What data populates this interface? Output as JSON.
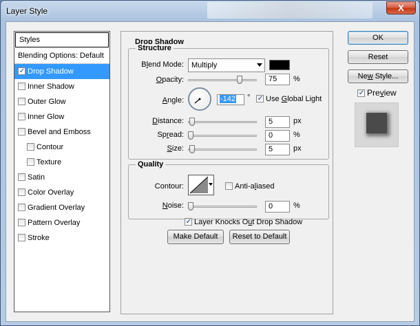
{
  "window": {
    "title": "Layer Style",
    "close_label": "X"
  },
  "styles_list": {
    "header": "Styles",
    "blending_options": "Blending Options: Default",
    "items": [
      {
        "label": "Drop Shadow",
        "checked": true,
        "selected": true,
        "sub": false
      },
      {
        "label": "Inner Shadow",
        "checked": false,
        "selected": false,
        "sub": false
      },
      {
        "label": "Outer Glow",
        "checked": false,
        "selected": false,
        "sub": false
      },
      {
        "label": "Inner Glow",
        "checked": false,
        "selected": false,
        "sub": false
      },
      {
        "label": "Bevel and Emboss",
        "checked": false,
        "selected": false,
        "sub": false
      },
      {
        "label": "Contour",
        "checked": false,
        "selected": false,
        "sub": true
      },
      {
        "label": "Texture",
        "checked": false,
        "selected": false,
        "sub": true
      },
      {
        "label": "Satin",
        "checked": false,
        "selected": false,
        "sub": false
      },
      {
        "label": "Color Overlay",
        "checked": false,
        "selected": false,
        "sub": false
      },
      {
        "label": "Gradient Overlay",
        "checked": false,
        "selected": false,
        "sub": false
      },
      {
        "label": "Pattern Overlay",
        "checked": false,
        "selected": false,
        "sub": false
      },
      {
        "label": "Stroke",
        "checked": false,
        "selected": false,
        "sub": false
      }
    ]
  },
  "drop_shadow": {
    "title": "Drop Shadow",
    "structure": {
      "title": "Structure",
      "blend_mode_label_pre": "B",
      "blend_mode_label_u": "l",
      "blend_mode_label_post": "end Mode:",
      "blend_mode_value": "Multiply",
      "shadow_color": "#000000",
      "opacity_label_u": "O",
      "opacity_label_post": "pacity:",
      "opacity_value": "75",
      "opacity_level": 75,
      "angle_label_u": "A",
      "angle_label_post": "ngle:",
      "angle_value": "-142",
      "degree_symbol": "°",
      "use_global_light_pre": "Use ",
      "use_global_light_u": "G",
      "use_global_light_post": "lobal Light",
      "use_global_light_checked": true,
      "distance_label_u": "D",
      "distance_label_post": "istance:",
      "distance_value": "5",
      "distance_unit": "px",
      "spread_label_pre": "Sp",
      "spread_label_u": "r",
      "spread_label_post": "ead:",
      "spread_value": "0",
      "spread_unit": "%",
      "size_label_u": "S",
      "size_label_post": "ize:",
      "size_value": "5",
      "size_unit": "px",
      "opacity_unit": "%"
    },
    "quality": {
      "title": "Quality",
      "contour_label": "Contour:",
      "anti_aliased_pre": "Anti-a",
      "anti_aliased_u": "l",
      "anti_aliased_post": "iased",
      "anti_aliased_checked": false,
      "noise_label_u": "N",
      "noise_label_post": "oise:",
      "noise_value": "0",
      "noise_unit": "%"
    },
    "knocks_out_pre": "Layer Knocks O",
    "knocks_out_u": "u",
    "knocks_out_post": "t Drop Shadow",
    "knocks_out_checked": true,
    "make_default": "Make Default",
    "reset_to_default": "Reset to Default"
  },
  "buttons": {
    "ok": "OK",
    "reset": "Reset",
    "new_style_pre": "Ne",
    "new_style_u": "w",
    "new_style_post": " Style...",
    "preview_pre": "Pre",
    "preview_u": "v",
    "preview_post": "iew",
    "preview_checked": true
  }
}
